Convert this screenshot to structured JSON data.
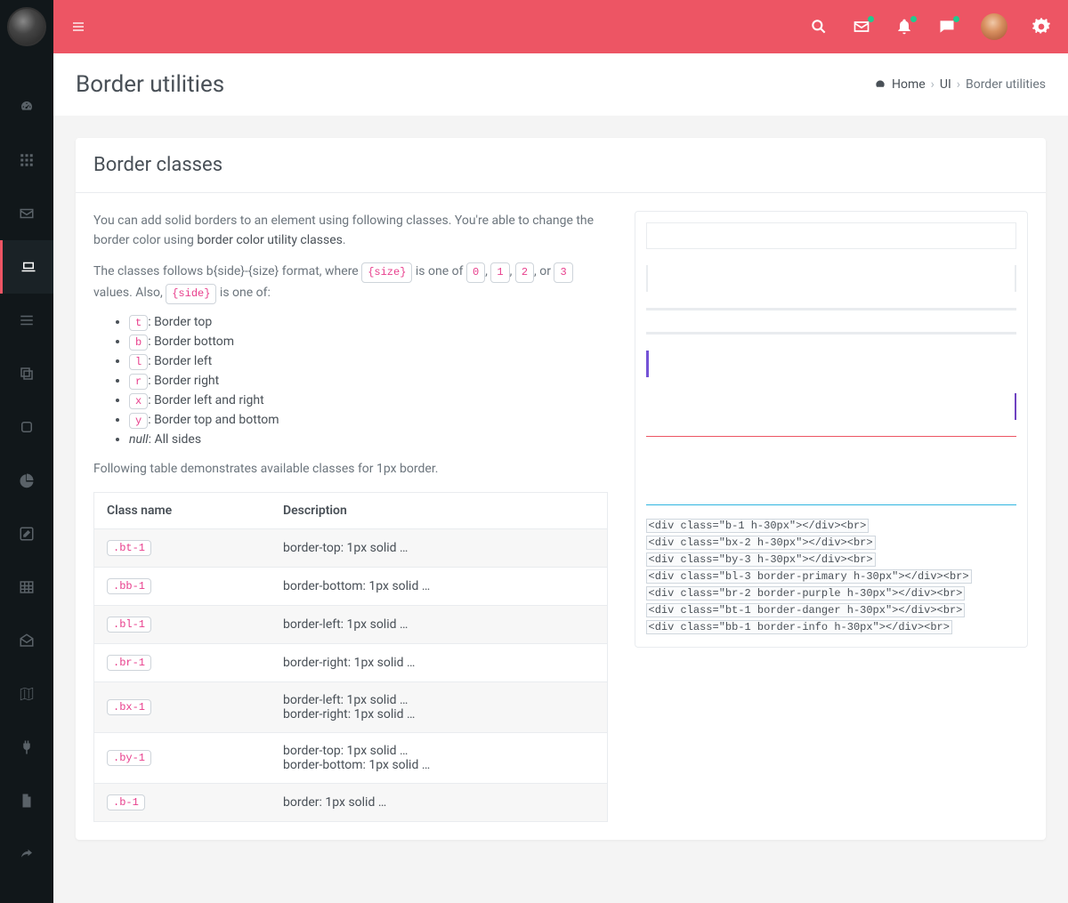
{
  "page": {
    "title": "Border utilities",
    "card_title": "Border classes"
  },
  "breadcrumb": {
    "home": "Home",
    "ui": "UI",
    "current": "Border utilities"
  },
  "intro": {
    "p1a": "You can add solid borders to an element using following classes. You're able to change the border color using ",
    "p1b": "border color utility classes",
    "p1c": ".",
    "p2a": "The classes follows b{side}-{size} format, where ",
    "p2_size": "{size}",
    "p2b": " is one of ",
    "v0": "0",
    "v1": "1",
    "v2": "2",
    "p2c": ", or ",
    "v3": "3",
    "p2d": " values. Also, ",
    "p2_side": "{side}",
    "p2e": " is one of:"
  },
  "sides": [
    {
      "code": "t",
      "label": ": Border top"
    },
    {
      "code": "b",
      "label": ": Border bottom"
    },
    {
      "code": "l",
      "label": ": Border left"
    },
    {
      "code": "r",
      "label": ": Border right"
    },
    {
      "code": "x",
      "label": ": Border left and right"
    },
    {
      "code": "y",
      "label": ": Border top and bottom"
    }
  ],
  "sides_null_em": "null",
  "sides_null_label": ": All sides",
  "table_intro": "Following table demonstrates available classes for 1px border.",
  "table": {
    "headers": [
      "Class name",
      "Description"
    ],
    "rows": [
      {
        "class": ".bt-1",
        "desc": [
          "border-top: 1px solid …"
        ]
      },
      {
        "class": ".bb-1",
        "desc": [
          "border-bottom: 1px solid …"
        ]
      },
      {
        "class": ".bl-1",
        "desc": [
          "border-left: 1px solid …"
        ]
      },
      {
        "class": ".br-1",
        "desc": [
          "border-right: 1px solid …"
        ]
      },
      {
        "class": ".bx-1",
        "desc": [
          "border-left: 1px solid …",
          "border-right: 1px solid …"
        ]
      },
      {
        "class": ".by-1",
        "desc": [
          "border-top: 1px solid …",
          "border-bottom: 1px solid …"
        ]
      },
      {
        "class": ".b-1",
        "desc": [
          "border: 1px solid …"
        ]
      }
    ]
  },
  "code_lines": [
    "<div class=\"b-1 h-30px\"></div><br>",
    "<div class=\"bx-2 h-30px\"></div><br>",
    "<div class=\"by-3 h-30px\"></div><br>",
    "<div class=\"bl-3 border-primary h-30px\"></div><br>",
    "<div class=\"br-2 border-purple h-30px\"></div><br>",
    "<div class=\"bt-1 border-danger h-30px\"></div><br>",
    "<div class=\"bb-1 border-info h-30px\"></div><br>"
  ]
}
